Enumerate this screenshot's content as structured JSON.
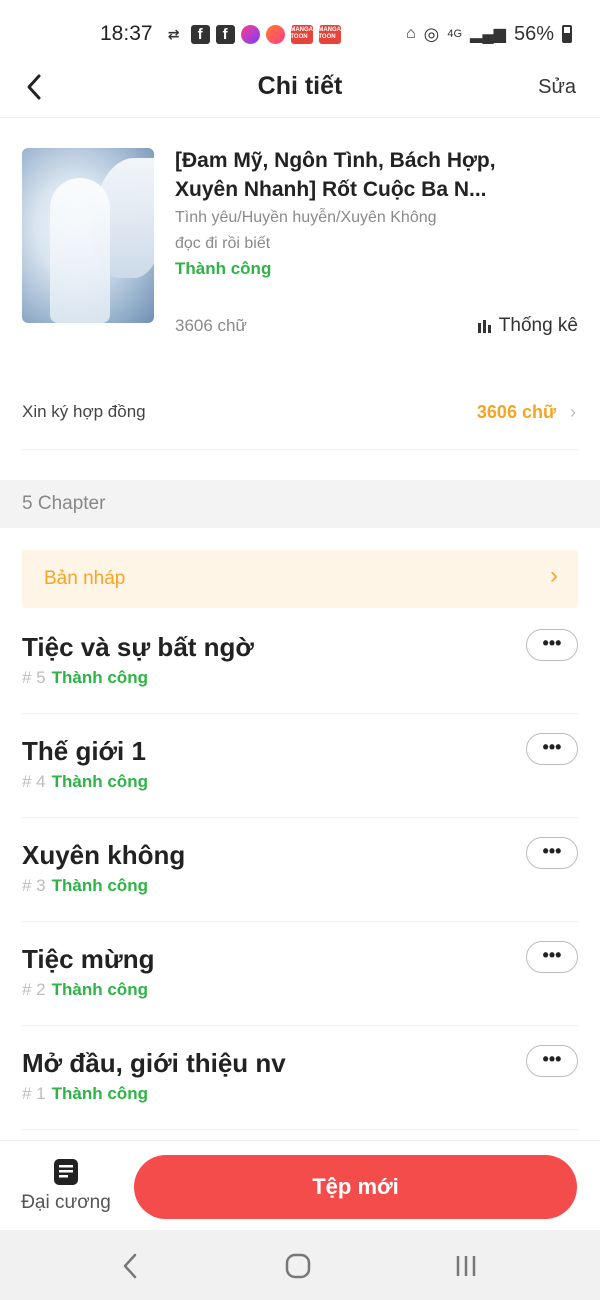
{
  "status_bar": {
    "time": "18:37",
    "battery": "56%",
    "network": "4G",
    "fb_icon": "f",
    "manga_icon_text": "MANGA TOON"
  },
  "header": {
    "title": "Chi tiết",
    "edit_label": "Sửa"
  },
  "book": {
    "title": "[Đam Mỹ, Ngôn Tình, Bách Hợp,\nXuyên Nhanh] Rốt Cuộc Ba N...",
    "genre": "Tình yêu/Huyền huyễn/Xuyên Không",
    "description": "đọc đi rồi biết",
    "status": "Thành công",
    "word_count": "3606 chữ",
    "stats_label": "Thống kê"
  },
  "contract": {
    "label": "Xin ký hợp đồng",
    "value": "3606 chữ",
    "chevron": "›"
  },
  "chapters_section": {
    "title": "5 Chapter",
    "draft_label": "Bản nháp",
    "draft_chevron": "›",
    "more_label": "•••",
    "items": [
      {
        "title": "Tiệc và sự bất ngờ",
        "number": "# 5",
        "status": "Thành công"
      },
      {
        "title": "Thế giới 1",
        "number": "# 4",
        "status": "Thành công"
      },
      {
        "title": "Xuyên không",
        "number": "# 3",
        "status": "Thành công"
      },
      {
        "title": "Tiệc mừng",
        "number": "# 2",
        "status": "Thành công"
      },
      {
        "title": "Mở đầu, giới thiệu nv",
        "number": "# 1",
        "status": "Thành công"
      }
    ]
  },
  "bottom_bar": {
    "outline_label": "Đại cương",
    "new_button_label": "Tệp mới"
  },
  "colors": {
    "accent_red": "#f44b4b",
    "success_green": "#2fb347",
    "warning_orange": "#f5a524"
  },
  "icons": {
    "back": "chevron-left-icon",
    "stats": "bar-chart-icon",
    "outline": "document-icon",
    "more": "ellipsis-icon"
  }
}
